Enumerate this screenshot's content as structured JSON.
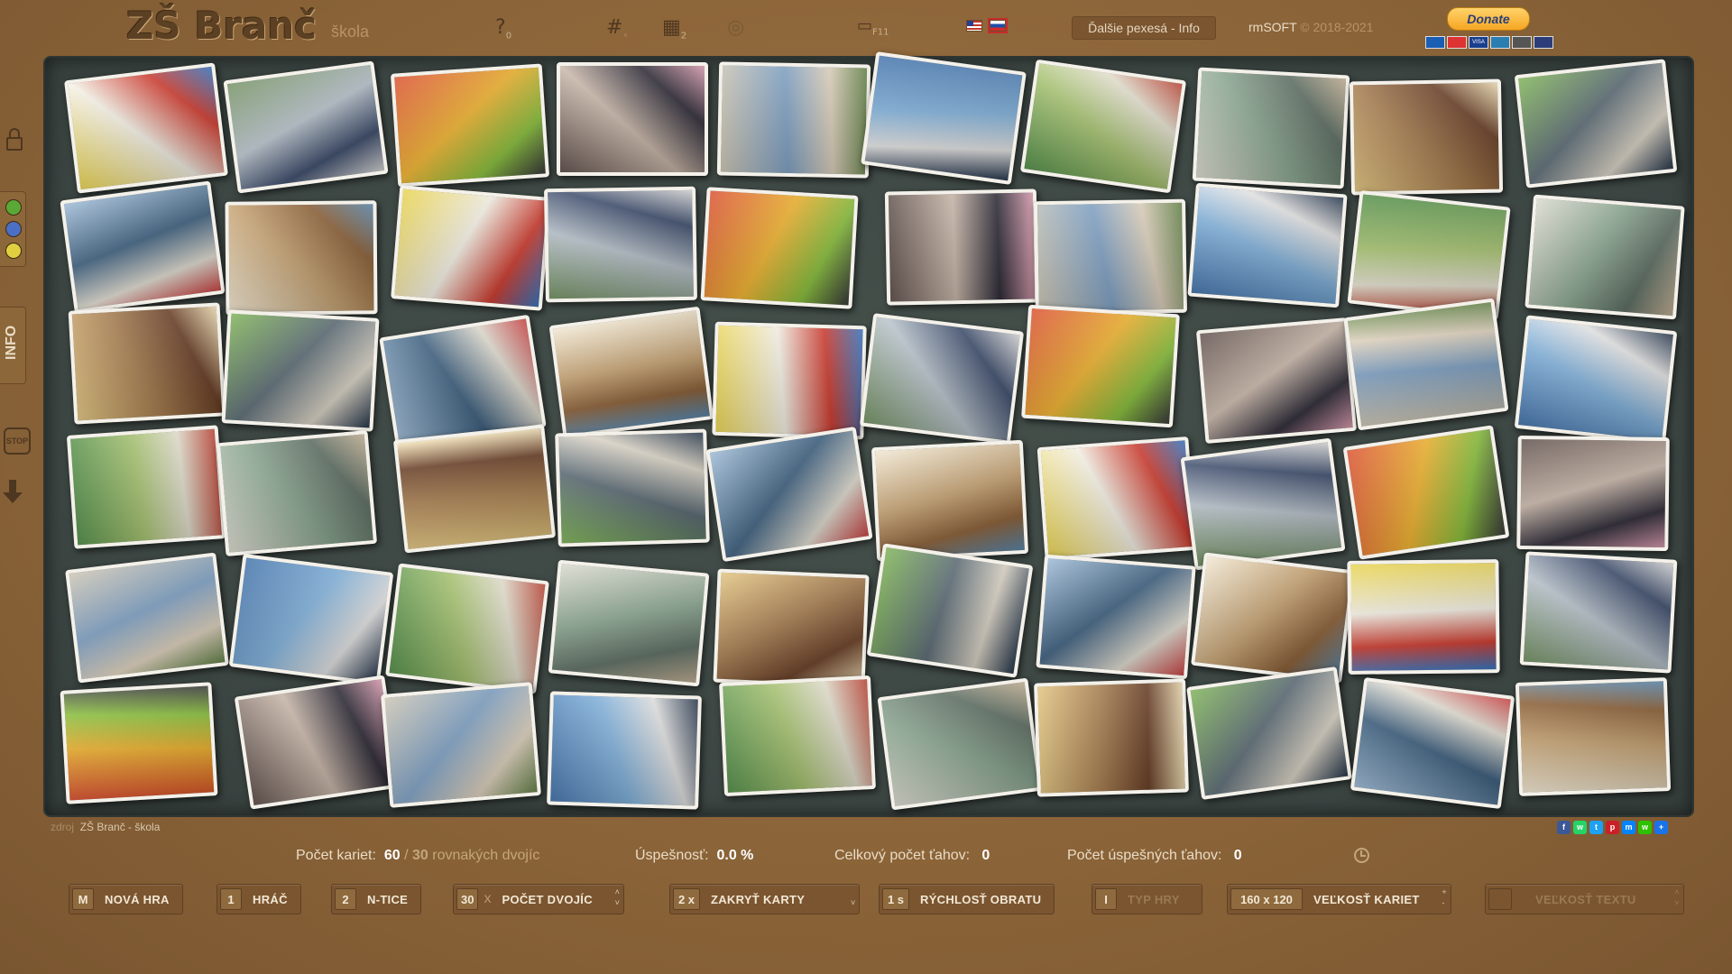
{
  "header": {
    "title": "ZŠ Branč",
    "subtitle": "škola",
    "icons": [
      {
        "name": "help-icon",
        "glyph": "?",
        "badge": "0"
      },
      {
        "name": "hash-icon",
        "glyph": "#",
        "badge": ""
      },
      {
        "name": "grid-icon",
        "glyph": "▦",
        "badge": "2"
      },
      {
        "name": "sound-icon",
        "glyph": "◎",
        "badge": ""
      },
      {
        "name": "fullscreen-icon",
        "glyph": "🖵",
        "badge": "F11"
      }
    ],
    "info_button": "Ďalšie pexesá - Info",
    "copyright_brand": "rmSOFT",
    "copyright_years": "© 2018-2021",
    "donate_label": "Donate"
  },
  "board": {
    "card_count_shown": 60,
    "photo_palettes": [
      [
        "#e8d24a",
        "#f6f2e6",
        "#d23b2e",
        "#3b7bc8"
      ],
      [
        "#6f8e5e",
        "#b9c3cc",
        "#3a4a6a",
        "#dcdcdc"
      ],
      [
        "#d94c2b",
        "#f0b12a",
        "#8ac23b",
        "#3d3d3d"
      ],
      [
        "#5a4b46",
        "#c9b6a8",
        "#2d2a36",
        "#e0a1b5"
      ],
      [
        "#c9c2b0",
        "#7da0c4",
        "#e2d5c0",
        "#6b8a4e"
      ],
      [
        "#3e6fa8",
        "#7fb1dc",
        "#e6e6e6",
        "#2b3b52"
      ],
      [
        "#4d8a43",
        "#a6c36e",
        "#e8e4d2",
        "#c24a3a"
      ],
      [
        "#d8d8cc",
        "#8aa68f",
        "#5d6e63",
        "#c8b69a"
      ],
      [
        "#e1c27c",
        "#a4794a",
        "#6a3f25",
        "#f4e2b8"
      ],
      [
        "#7ab053",
        "#5a6a74",
        "#ddd6c8",
        "#2a3b4f"
      ],
      [
        "#9ab8d4",
        "#3a5d7d",
        "#e4e0d4",
        "#d24a4a"
      ],
      [
        "#f0e6d0",
        "#c6a271",
        "#8b5e34",
        "#5e8bb0"
      ]
    ]
  },
  "footer": {
    "source_label": "zdroj",
    "source_value": "ZŠ Branč - škola",
    "share_icons": [
      "f",
      "w",
      "t",
      "p",
      "m",
      "w",
      "+"
    ],
    "stats": {
      "cards_label": "Počet kariet:",
      "cards_value": "60",
      "pairs_value": "30",
      "pairs_label": "rovnakých dvojíc",
      "success_label": "Úspešnosť:",
      "success_value": "0.0 %",
      "moves_label": "Celkový počet ťahov:",
      "moves_value": "0",
      "good_moves_label": "Počet úspešných ťahov:",
      "good_moves_value": "0"
    },
    "controls": {
      "new_game_key": "M",
      "new_game_label": "NOVÁ HRA",
      "player_key": "1",
      "player_label": "HRÁČ",
      "ntice_key": "2",
      "ntice_label": "N-TICE",
      "pairs_key": "30",
      "pairs_x": "X",
      "pairs_label": "POČET DVOJÍC",
      "hide_key": "2 x",
      "hide_label": "ZAKRYŤ KARTY",
      "speed_key": "1 s",
      "speed_label": "RÝCHLOSŤ OBRATU",
      "type_key": "I",
      "type_label": "TYP HRY",
      "size_key": "160 x 120",
      "size_label": "VEĽKOSŤ KARIET",
      "text_key": "",
      "text_label": "VEĽKOSŤ TEXTU"
    }
  }
}
